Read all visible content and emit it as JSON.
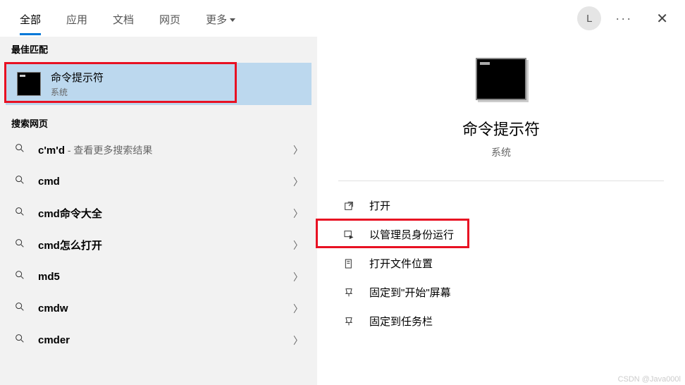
{
  "header": {
    "tabs": [
      {
        "label": "全部",
        "active": true
      },
      {
        "label": "应用",
        "active": false
      },
      {
        "label": "文档",
        "active": false
      },
      {
        "label": "网页",
        "active": false
      },
      {
        "label": "更多",
        "active": false,
        "dropdown": true
      }
    ],
    "avatar_initial": "L"
  },
  "left": {
    "best_match_header": "最佳匹配",
    "best_match": {
      "title": "命令提示符",
      "subtitle": "系统"
    },
    "search_web_header": "搜索网页",
    "items": [
      {
        "label": "c'm'd",
        "hint": " - 查看更多搜索结果"
      },
      {
        "label": "cmd",
        "hint": ""
      },
      {
        "label": "cmd命令大全",
        "hint": ""
      },
      {
        "label": "cmd怎么打开",
        "hint": ""
      },
      {
        "label": "md5",
        "hint": ""
      },
      {
        "label": "cmdw",
        "hint": ""
      },
      {
        "label": "cmder",
        "hint": ""
      }
    ]
  },
  "right": {
    "title": "命令提示符",
    "subtitle": "系统",
    "actions": [
      {
        "icon": "open-icon",
        "label": "打开"
      },
      {
        "icon": "admin-icon",
        "label": "以管理员身份运行",
        "highlight": true
      },
      {
        "icon": "folder-icon",
        "label": "打开文件位置"
      },
      {
        "icon": "pin-start-icon",
        "label": "固定到\"开始\"屏幕"
      },
      {
        "icon": "pin-taskbar-icon",
        "label": "固定到任务栏"
      }
    ]
  },
  "watermark": "CSDN @Java000l"
}
